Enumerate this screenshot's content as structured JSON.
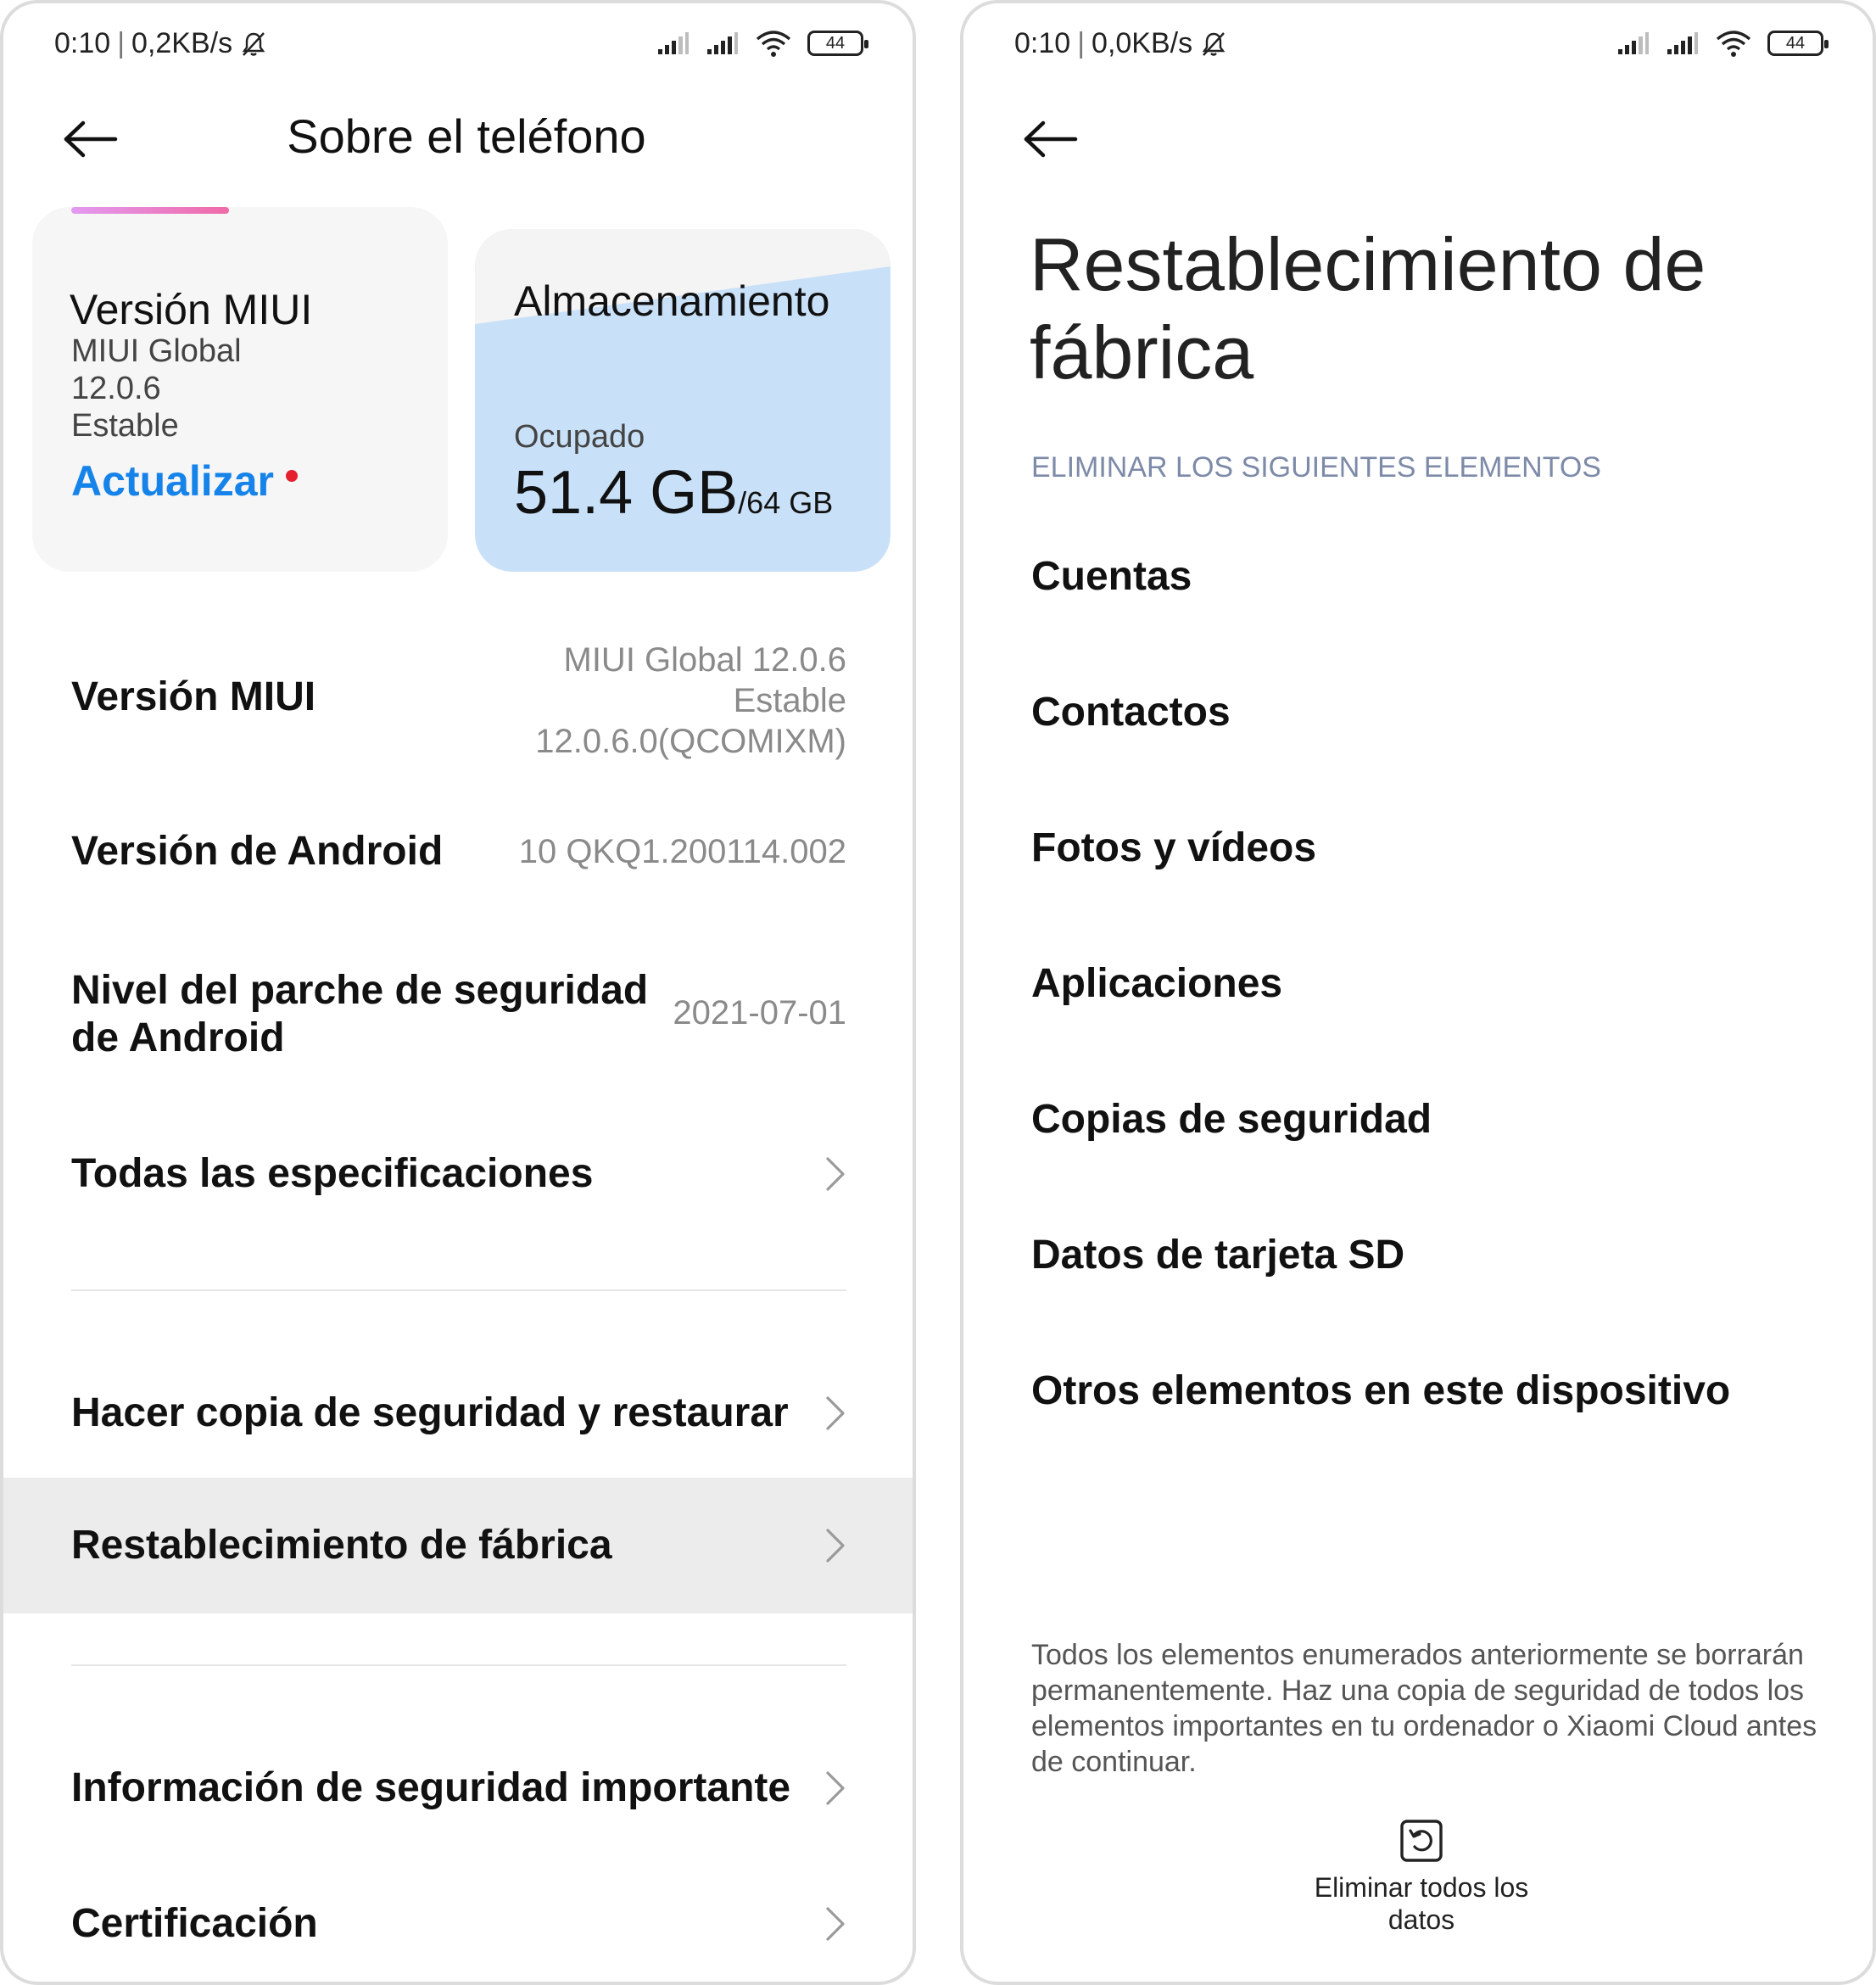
{
  "left_screen": {
    "status": {
      "time": "0:10",
      "speed": "0,2KB/s",
      "battery": "44"
    },
    "header": {
      "title": "Sobre el teléfono"
    },
    "miui_card": {
      "title": "Versión MIUI",
      "line1": "MIUI Global",
      "line2": "12.0.6",
      "line3": "Estable",
      "update_label": "Actualizar"
    },
    "storage_card": {
      "title": "Almacenamiento",
      "used_label": "Ocupado",
      "used_value": "51.4 GB",
      "total": "/64 GB",
      "used_fraction": 0.803
    },
    "rows": {
      "miui_version": {
        "title": "Versión MIUI",
        "value1": "MIUI Global 12.0.6",
        "value2": "Estable",
        "value3": "12.0.6.0(QCOMIXM)"
      },
      "android_version": {
        "title": "Versión de Android",
        "value": "10 QKQ1.200114.002"
      },
      "security_patch": {
        "title1": "Nivel del parche de seguridad",
        "title2": "de Android",
        "value": "2021-07-01"
      },
      "all_specs": {
        "title": "Todas las especificaciones"
      },
      "backup": {
        "title": "Hacer copia de seguridad y restaurar"
      },
      "factory_reset": {
        "title": "Restablecimiento de fábrica"
      },
      "safety_info": {
        "title": "Información de seguridad importante"
      },
      "certification": {
        "title": "Certificación"
      }
    }
  },
  "right_screen": {
    "status": {
      "time": "0:10",
      "speed": "0,0KB/s",
      "battery": "44"
    },
    "title_line1": "Restablecimiento de",
    "title_line2": "fábrica",
    "section_header": "ELIMINAR LOS SIGUIENTES ELEMENTOS",
    "items": [
      "Cuentas",
      "Contactos",
      "Fotos y vídeos",
      "Aplicaciones",
      "Copias de seguridad",
      "Datos de tarjeta SD",
      "Otros elementos en este dispositivo"
    ],
    "warning": "Todos los elementos enumerados anteriormente se borrarán permanentemente. Haz una copia de seguridad de todos los elementos importantes en tu ordenador o Xiaomi Cloud antes de continuar.",
    "erase_button_label": "Eliminar todos los datos"
  },
  "colors": {
    "accent_blue": "#1583e9",
    "notification_red": "#e4212d",
    "storage_card": "#c9e1f8",
    "highlight_row": "#ececec",
    "section_header": "#7d8aa8"
  },
  "icons": [
    "back-arrow-icon",
    "signal-icon",
    "wifi-icon",
    "battery-icon",
    "mute-bell-icon",
    "chevron-right-icon",
    "reset-icon"
  ]
}
